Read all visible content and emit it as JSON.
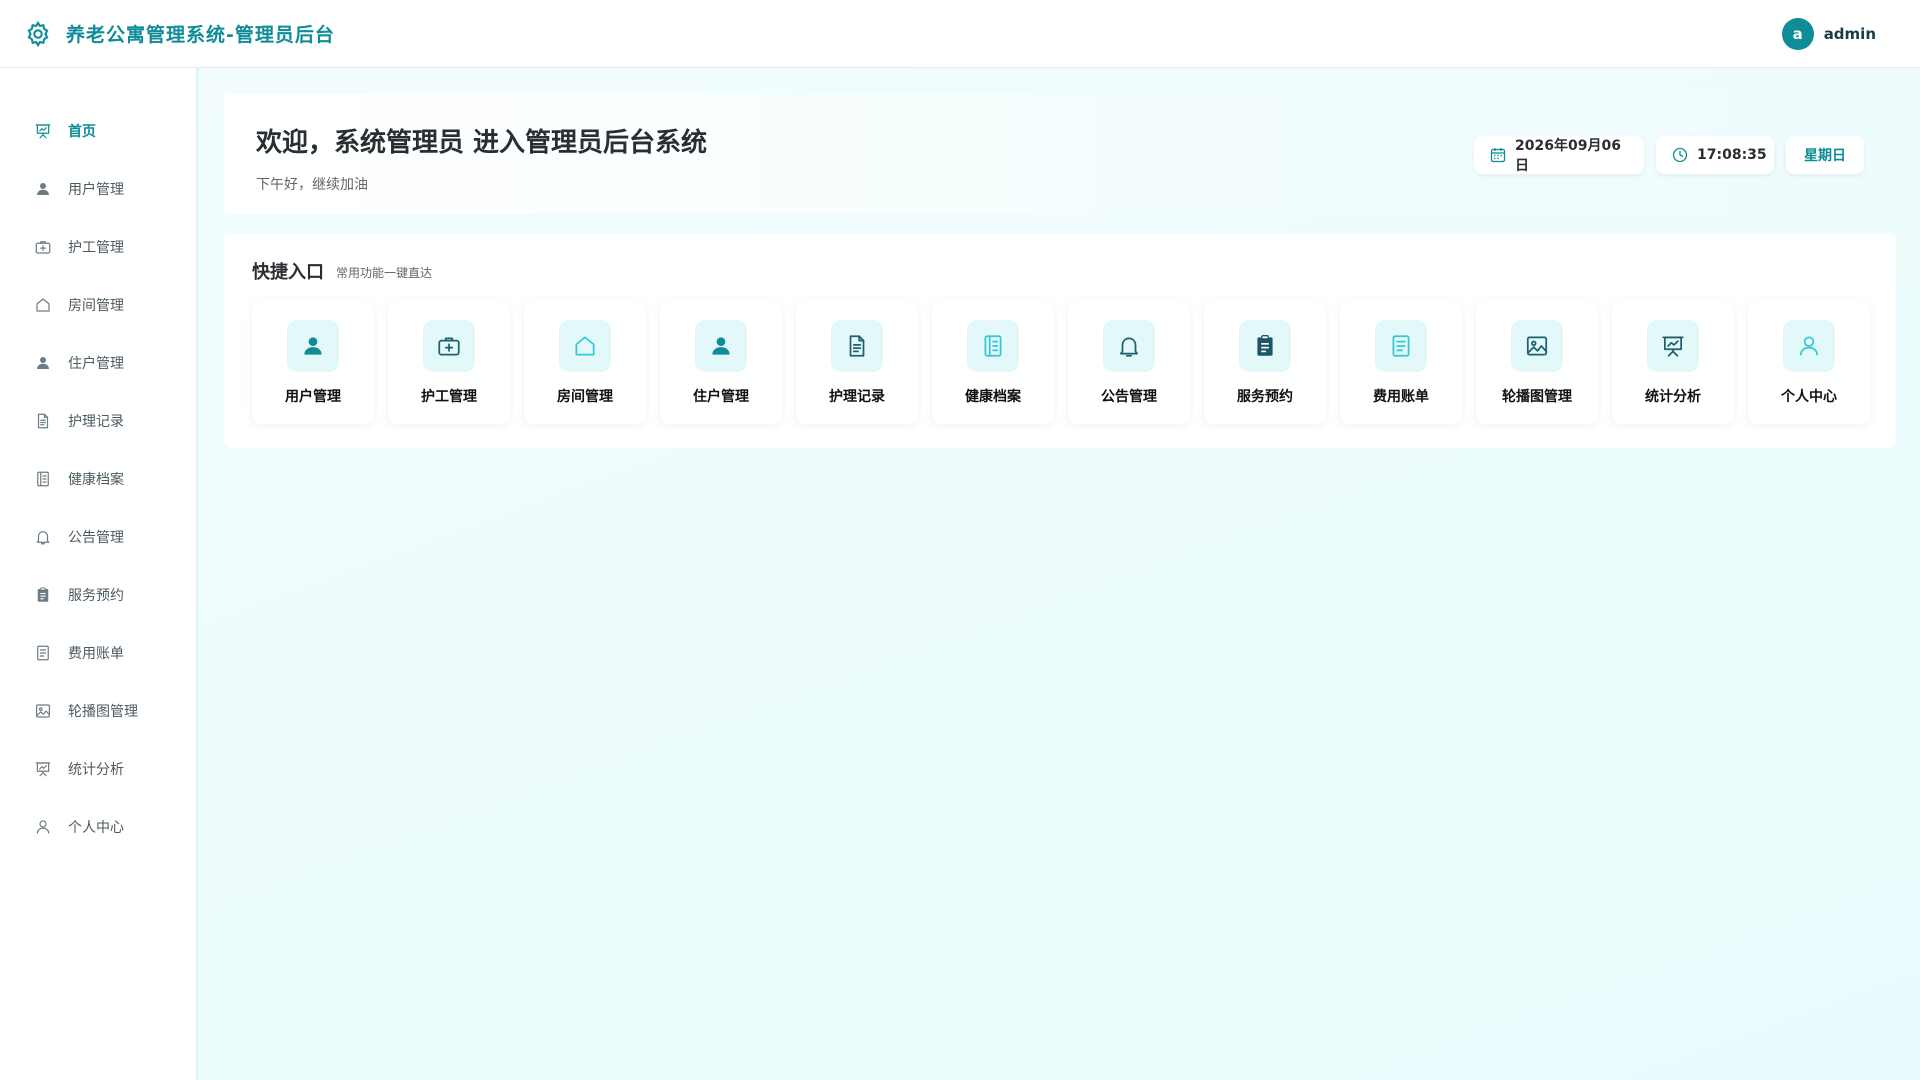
{
  "header": {
    "title": "养老公寓管理系统-管理员后台",
    "logo_icon": "gear-icon",
    "user": {
      "avatar_letter": "a",
      "name": "admin"
    }
  },
  "colors": {
    "brand": "#0e8c98",
    "card_icon_bg": "#e3f8f8"
  },
  "sidebar": {
    "items": [
      {
        "label": "首页",
        "icon": "presentation-chart-icon",
        "active": true
      },
      {
        "label": "用户管理",
        "icon": "user-icon"
      },
      {
        "label": "护工管理",
        "icon": "medical-kit-icon"
      },
      {
        "label": "房间管理",
        "icon": "home-icon"
      },
      {
        "label": "住户管理",
        "icon": "user-icon"
      },
      {
        "label": "护理记录",
        "icon": "document-icon"
      },
      {
        "label": "健康档案",
        "icon": "notebook-icon"
      },
      {
        "label": "公告管理",
        "icon": "bell-icon"
      },
      {
        "label": "服务预约",
        "icon": "clipboard-icon"
      },
      {
        "label": "费用账单",
        "icon": "bill-icon"
      },
      {
        "label": "轮播图管理",
        "icon": "picture-icon"
      },
      {
        "label": "统计分析",
        "icon": "presentation-chart-icon"
      },
      {
        "label": "个人中心",
        "icon": "user-outline-icon"
      }
    ]
  },
  "welcome": {
    "title": "欢迎，系统管理员 进入管理员后台系统",
    "subtitle": "下午好，继续加油",
    "date": "2026年09月06日",
    "time": "17:08:35",
    "weekday": "星期日"
  },
  "quick": {
    "title": "快捷入口",
    "subtitle": "常用功能一键直达",
    "cards": [
      {
        "label": "用户管理",
        "icon": "user-icon",
        "color": "#0e8c98"
      },
      {
        "label": "护工管理",
        "icon": "medical-kit-icon",
        "color": "#1d6170"
      },
      {
        "label": "房间管理",
        "icon": "home-icon",
        "color": "#35c8d4"
      },
      {
        "label": "住户管理",
        "icon": "user-icon",
        "color": "#0e8c98"
      },
      {
        "label": "护理记录",
        "icon": "document-icon",
        "color": "#1d6170"
      },
      {
        "label": "健康档案",
        "icon": "notebook-icon",
        "color": "#35c8d4"
      },
      {
        "label": "公告管理",
        "icon": "bell-icon",
        "color": "#1d6170"
      },
      {
        "label": "服务预约",
        "icon": "clipboard-icon",
        "color": "#1d5766"
      },
      {
        "label": "费用账单",
        "icon": "bill-icon",
        "color": "#35c8d4"
      },
      {
        "label": "轮播图管理",
        "icon": "picture-icon",
        "color": "#1d6170"
      },
      {
        "label": "统计分析",
        "icon": "presentation-chart-icon",
        "color": "#1d6170"
      },
      {
        "label": "个人中心",
        "icon": "user-outline-icon",
        "color": "#35c8d4"
      }
    ]
  }
}
